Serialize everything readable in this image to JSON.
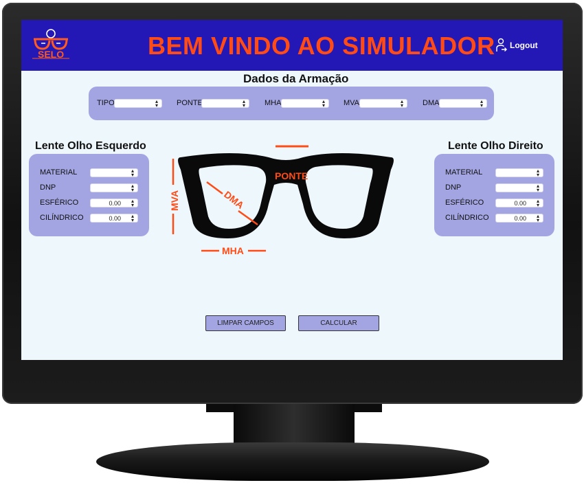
{
  "header": {
    "logo_text": "SELO",
    "title": "BEM VINDO AO SIMULADOR",
    "logout_label": "Logout"
  },
  "frame": {
    "title": "Dados da Armação",
    "fields": [
      {
        "label": "TIPO",
        "value": ""
      },
      {
        "label": "PONTE",
        "value": ""
      },
      {
        "label": "MHA",
        "value": ""
      },
      {
        "label": "MVA",
        "value": ""
      },
      {
        "label": "DMA",
        "value": ""
      }
    ]
  },
  "left_lens": {
    "title": "Lente Olho Esquerdo",
    "fields": [
      {
        "label": "MATERIAL",
        "value": ""
      },
      {
        "label": "DNP",
        "value": ""
      },
      {
        "label": "ESFÉRICO",
        "value": "0.00"
      },
      {
        "label": "CILÍNDRICO",
        "value": "0.00"
      }
    ]
  },
  "right_lens": {
    "title": "Lente Olho Direito",
    "fields": [
      {
        "label": "MATERIAL",
        "value": ""
      },
      {
        "label": "DNP",
        "value": ""
      },
      {
        "label": "ESFÉRICO",
        "value": "0.00"
      },
      {
        "label": "CILÍNDRICO",
        "value": "0.00"
      }
    ]
  },
  "diagram": {
    "ponte": "PONTE",
    "dma": "DMA",
    "mva": "MVA",
    "mha": "MHA"
  },
  "actions": {
    "clear_label": "LIMPAR CAMPOS",
    "calc_label": "CALCULAR"
  },
  "colors": {
    "header_bg": "#2318b5",
    "accent_orange": "#ff4c17",
    "panel_bg": "#a3a5e3",
    "screen_bg": "#eef7fc"
  }
}
